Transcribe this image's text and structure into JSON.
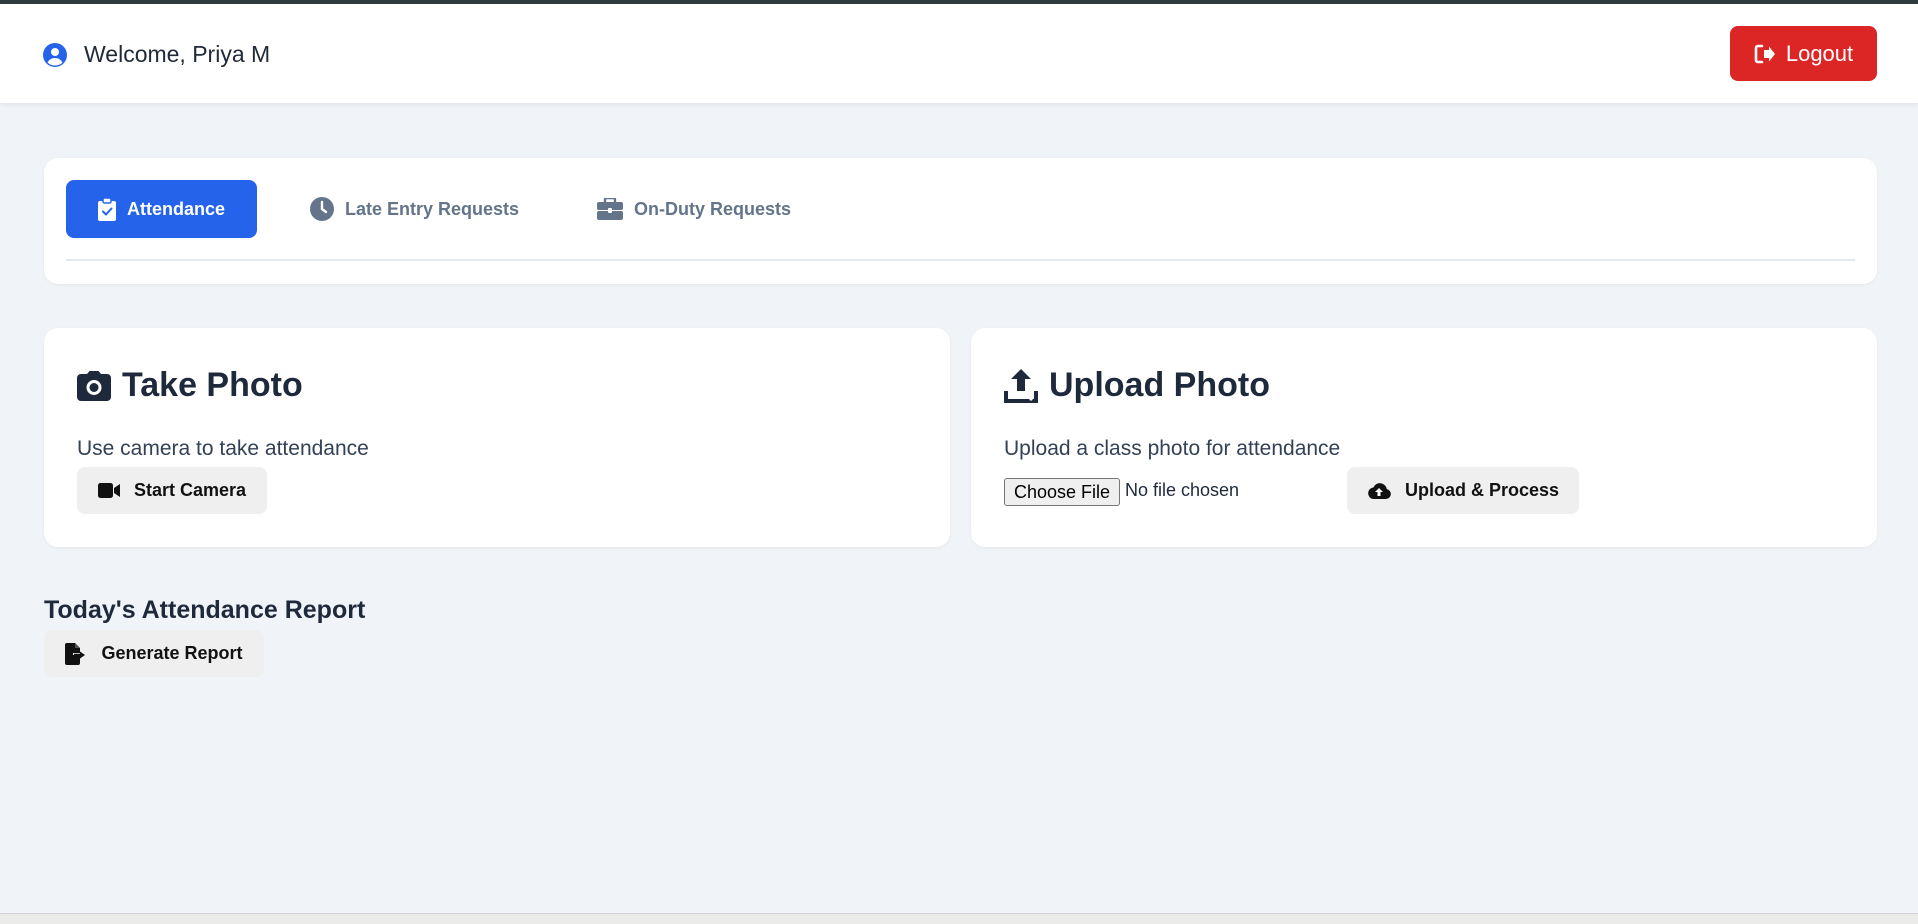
{
  "header": {
    "welcome": "Welcome, Priya M",
    "logout_label": "Logout",
    "user_icon": "user-circle-icon",
    "logout_icon": "sign-out-icon"
  },
  "tabs": [
    {
      "label": "Attendance",
      "icon": "clipboard-check-icon",
      "active": true
    },
    {
      "label": "Late Entry Requests",
      "icon": "clock-icon",
      "active": false
    },
    {
      "label": "On-Duty Requests",
      "icon": "briefcase-icon",
      "active": false
    }
  ],
  "take_photo": {
    "title": "Take Photo",
    "description": "Use camera to take attendance",
    "button_label": "Start Camera",
    "icon": "camera-icon",
    "button_icon": "video-icon"
  },
  "upload_photo": {
    "title": "Upload Photo",
    "description": "Upload a class photo for attendance",
    "file_button_label": "Choose File",
    "file_status": "No file chosen",
    "button_label": "Upload & Process",
    "icon": "upload-icon",
    "button_icon": "cloud-upload-icon"
  },
  "report": {
    "title": "Today's Attendance Report",
    "button_label": "Generate Report",
    "button_icon": "file-export-icon"
  },
  "colors": {
    "primary": "#2563eb",
    "danger": "#dc2626",
    "background": "#f0f3f8",
    "text_dark": "#1e293b",
    "tab_inactive": "#64748b"
  }
}
